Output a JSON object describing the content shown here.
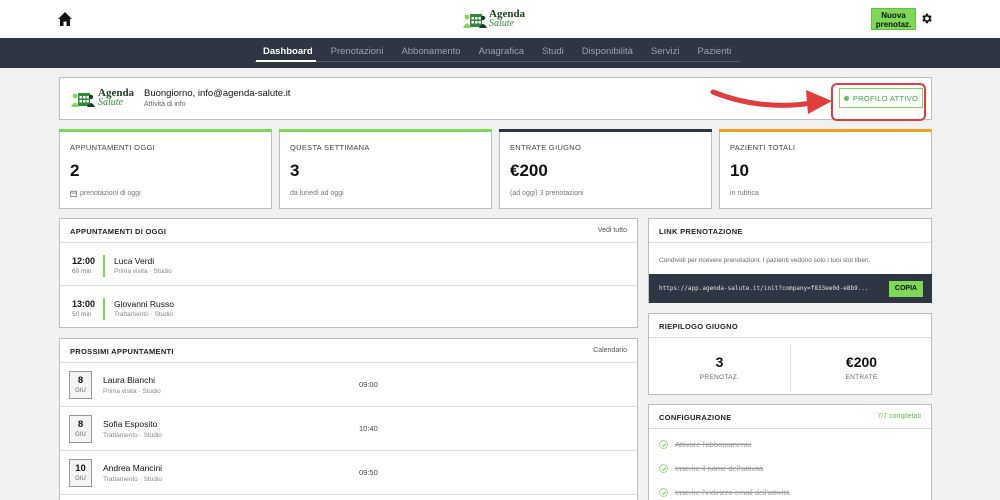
{
  "header": {
    "brand_line1": "Agenda",
    "brand_line2": "Salute",
    "new_booking_line1": "Nuova",
    "new_booking_line2": "prenotaz."
  },
  "nav": {
    "tabs": [
      "Dashboard",
      "Prenotazioni",
      "Abbonamento",
      "Anagrafica",
      "Studi",
      "Disponibilità",
      "Servizi",
      "Pazienti"
    ],
    "active_tab": "Dashboard"
  },
  "welcome": {
    "greeting": "Buongiorno, info@agenda-salute.it",
    "subtitle": "Attività di info",
    "profile_status": "PROFILO ATTIVO"
  },
  "stats": [
    {
      "label": "APPUNTAMENTI OGGI",
      "value": "2",
      "sub": "prenotazioni di oggi",
      "accent": "#7ed957"
    },
    {
      "label": "QUESTA SETTIMANA",
      "value": "3",
      "sub": "da lunedì ad oggi",
      "accent": "#7ed957"
    },
    {
      "label": "ENTRATE GIUGNO",
      "value": "€200",
      "sub": "(ad oggi) 3 prenotazioni",
      "accent": "#2d3642"
    },
    {
      "label": "PAZIENTI TOTALI",
      "value": "10",
      "sub": "in rubrica",
      "accent": "#f0a020"
    }
  ],
  "today": {
    "title": "APPUNTAMENTI DI OGGI",
    "link": "Vedi tutto",
    "rows": [
      {
        "time": "12:00",
        "duration": "60 min",
        "name": "Luca Verdi",
        "type": "Prima visita · Studio"
      },
      {
        "time": "13:00",
        "duration": "50 min",
        "name": "Giovanni Russo",
        "type": "Trattamento · Studio"
      }
    ]
  },
  "upcoming": {
    "title": "PROSSIMI APPUNTAMENTI",
    "link": "Calendario",
    "rows": [
      {
        "day": "8",
        "month": "GIU",
        "name": "Laura Bianchi",
        "type": "Prima visita · Studio",
        "time": "09:00"
      },
      {
        "day": "8",
        "month": "GIU",
        "name": "Sofia Esposito",
        "type": "Trattamento · Studio",
        "time": "10:40"
      },
      {
        "day": "10",
        "month": "GIU",
        "name": "Andrea Mancini",
        "type": "Trattamento · Studio",
        "time": "09:50"
      }
    ]
  },
  "booking_link": {
    "title": "LINK PRENOTAZIONE",
    "description": "Condividi per ricevere prenotazioni. I pazienti vedono solo i tuoi slot liberi.",
    "url": "https://app.agenda-salute.it/init?company=f833ee0d-e8b9...",
    "copy_label": "COPIA"
  },
  "summary": {
    "title": "RIEPILOGO GIUGNO",
    "bookings_value": "3",
    "bookings_label": "PRENOTAZ.",
    "income_value": "€200",
    "income_label": "ENTRATE"
  },
  "config": {
    "title": "CONFIGURAZIONE",
    "progress": "7/7 completati",
    "items": [
      "Attivare l'abbonamento",
      "Inserire il nome dell'attività",
      "Inserire l'indirizzo email dell'attività"
    ]
  }
}
